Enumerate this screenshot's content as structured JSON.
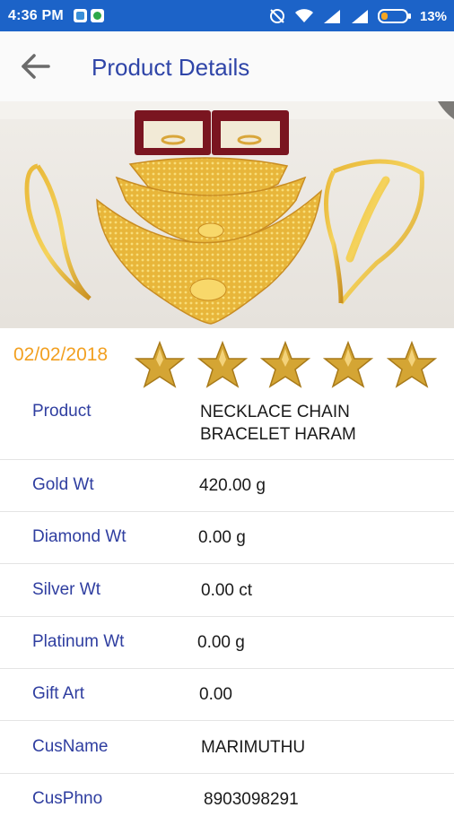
{
  "status_bar": {
    "time": "4:36 PM",
    "battery_percent": "13%",
    "icons": [
      "app-notification-icon",
      "app-notification-icon",
      "sync-off-icon",
      "wifi-icon",
      "signal-icon",
      "signal-icon",
      "battery-icon"
    ]
  },
  "header": {
    "title": "Product Details",
    "back_icon": "arrow-left-icon"
  },
  "product": {
    "date": "02/02/2018",
    "rating": 5,
    "rating_max": 5
  },
  "details": [
    {
      "label": "Product",
      "value": "NECKLACE CHAIN BRACELET HARAM"
    },
    {
      "label": "Gold Wt",
      "value": "420.00 g"
    },
    {
      "label": "Diamond Wt",
      "value": "0.00 g"
    },
    {
      "label": "Silver Wt",
      "value": "0.00 ct"
    },
    {
      "label": "Platinum Wt",
      "value": "0.00 g"
    },
    {
      "label": "Gift Art",
      "value": "0.00"
    },
    {
      "label": "CusName",
      "value": "MARIMUTHU"
    },
    {
      "label": "CusPhno",
      "value": "8903098291"
    }
  ],
  "colors": {
    "status_bar": "#1c63c8",
    "title": "#2f45a8",
    "label": "#2f3ea0",
    "date": "#f2a021",
    "star": "#d4a534"
  }
}
